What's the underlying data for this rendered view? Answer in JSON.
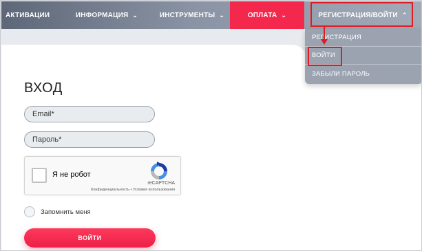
{
  "nav": {
    "items": [
      {
        "label": "АКТИВАЦИИ"
      },
      {
        "label": "ИНФОРМАЦИЯ",
        "chevron": "⌄"
      },
      {
        "label": "ИНСТРУМЕНТЫ",
        "chevron": "⌄"
      },
      {
        "label": "ОПЛАТА",
        "chevron": "⌄"
      },
      {
        "label": "РЕГИСТРАЦИЯ/ВОЙТИ",
        "chevron": "⌃"
      }
    ],
    "accent": "#f4284d"
  },
  "dropdown": {
    "items": [
      {
        "label": "РЕГИСТРАЦИЯ"
      },
      {
        "label": "ВОЙТИ"
      },
      {
        "label": "ЗАБЫЛИ ПАРОЛЬ"
      }
    ]
  },
  "login": {
    "title": "ВХОД",
    "email_placeholder": "Email*",
    "password_placeholder": "Пароль*",
    "remember_label": "Запомнить меня",
    "submit_label": "ВОЙТИ"
  },
  "captcha": {
    "label": "Я не робот",
    "brand": "reCAPTCHA",
    "terms": "Конфиденциальность • Условия использования"
  },
  "annotation": {
    "color": "#e01c23"
  }
}
